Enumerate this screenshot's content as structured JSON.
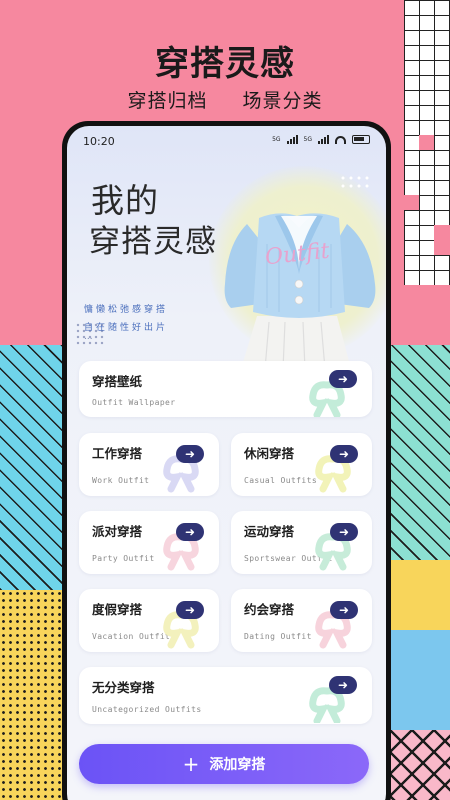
{
  "promo": {
    "title": "穿搭灵感",
    "subtitle_left": "穿搭归档",
    "subtitle_right": "场景分类"
  },
  "status_bar": {
    "time": "10:20",
    "network_a": "5G",
    "network_b": "5G"
  },
  "hero": {
    "title_line1": "我的",
    "title_line2": "穿搭灵感",
    "script_text": "Outfit",
    "tagline1": "慵懒松弛感穿搭",
    "tagline2": "自在随性好出片",
    "ellipsis": "..."
  },
  "categories": [
    {
      "title": "穿搭壁纸",
      "subtitle": "Outfit Wallpaper",
      "icon": "arrow-right-icon"
    },
    {
      "title": "工作穿搭",
      "subtitle": "Work Outfit",
      "icon": "arrow-right-icon"
    },
    {
      "title": "休闲穿搭",
      "subtitle": "Casual Outfits",
      "icon": "arrow-right-icon"
    },
    {
      "title": "派对穿搭",
      "subtitle": "Party Outfit",
      "icon": "arrow-right-icon"
    },
    {
      "title": "运动穿搭",
      "subtitle": "Sportswear Outfit",
      "icon": "arrow-right-icon"
    },
    {
      "title": "度假穿搭",
      "subtitle": "Vacation Outfit",
      "icon": "arrow-right-icon"
    },
    {
      "title": "约会穿搭",
      "subtitle": "Dating Outfit",
      "icon": "arrow-right-icon"
    },
    {
      "title": "无分类穿搭",
      "subtitle": "Uncategorized Outfits",
      "icon": "arrow-right-icon"
    }
  ],
  "add_button": {
    "label": "添加穿搭",
    "icon": "plus-icon"
  },
  "colors": {
    "accent": "#2f3374",
    "button_gradient_start": "#6b53f6",
    "button_gradient_end": "#8b68f9",
    "promo_pink": "#f6889f"
  }
}
